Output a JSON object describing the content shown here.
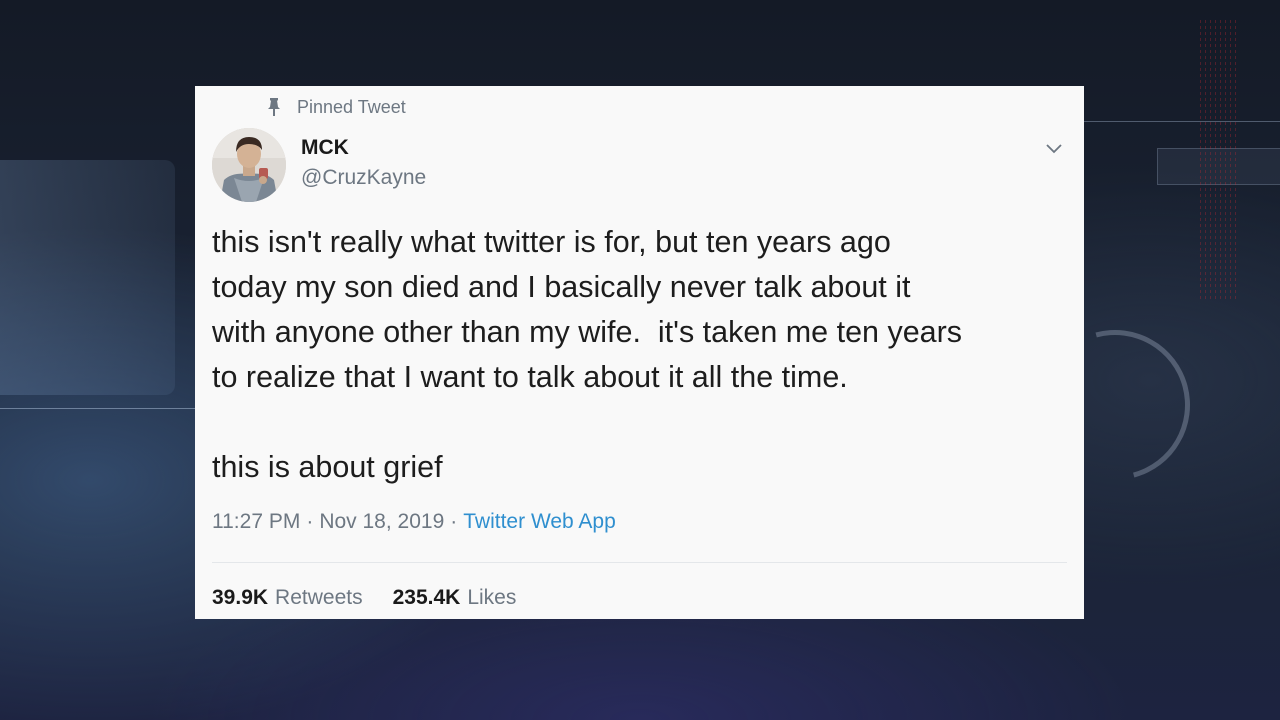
{
  "tweet": {
    "pinned_label": "Pinned Tweet",
    "author": {
      "display_name": "MCK",
      "handle": "@CruzKayne"
    },
    "text": "this isn't really what twitter is for, but ten years ago\ntoday my son died and I basically never talk about it\nwith anyone other than my wife.  it's taken me ten years\nto realize that I want to talk about it all the time.\n\nthis is about grief",
    "time": "11:27 PM",
    "separator": "·",
    "date": "Nov 18, 2019",
    "source": "Twitter Web App",
    "retweets_count": "39.9K",
    "retweets_label": "Retweets",
    "likes_count": "235.4K",
    "likes_label": "Likes"
  },
  "icons": {
    "pin": "pin-icon",
    "chevron": "chevron-down-icon",
    "avatar": "avatar"
  },
  "colors": {
    "card_bg": "#f9f9f9",
    "muted_text": "#6d7782",
    "link": "#2f8fcf",
    "primary_text": "#1d1d1d"
  }
}
